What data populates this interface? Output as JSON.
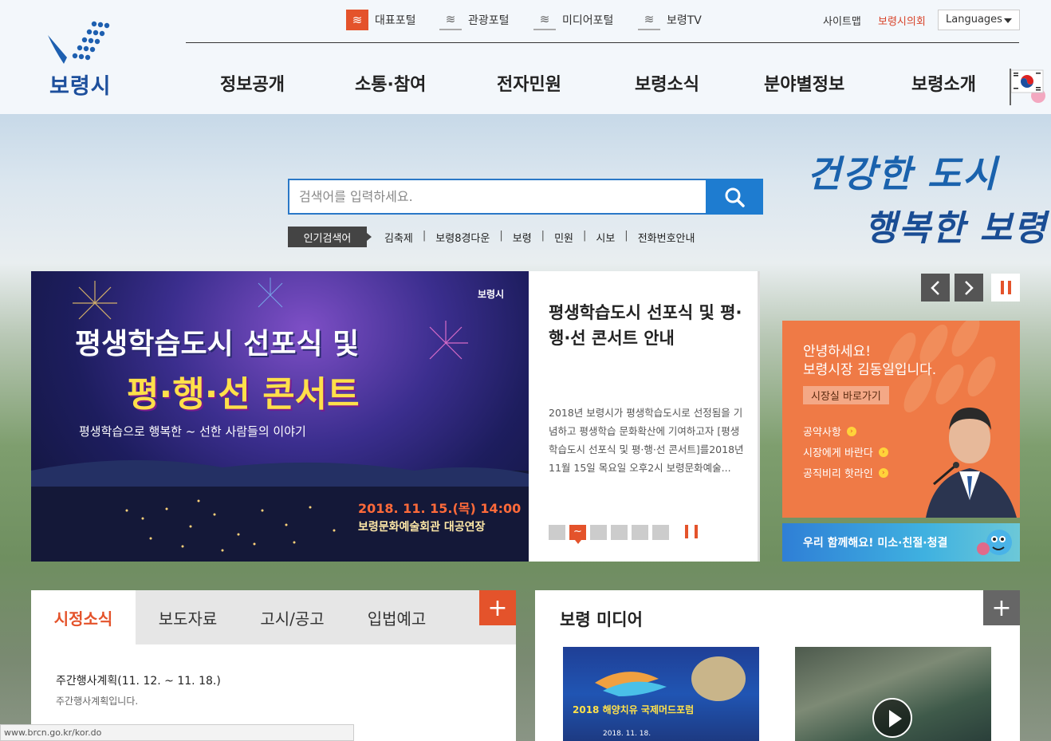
{
  "header": {
    "logo_text": "보령시",
    "portals": [
      {
        "label": "대표포털",
        "icon": "waves-icon",
        "active": true
      },
      {
        "label": "관광포털",
        "icon": "waves-icon",
        "active": false
      },
      {
        "label": "미디어포털",
        "icon": "waves-icon",
        "active": false
      },
      {
        "label": "보령TV",
        "icon": "waves-icon",
        "active": false
      }
    ],
    "util": {
      "sitemap": "사이트맵",
      "council": "보령시의회",
      "languages": "Languages"
    },
    "gnb": [
      "정보공개",
      "소통·참여",
      "전자민원",
      "보령소식",
      "분야별정보",
      "보령소개"
    ]
  },
  "slogan": {
    "line1": "건강한 도시",
    "line2": "행복한 보령"
  },
  "search": {
    "placeholder": "검색어를 입력하세요.",
    "popular_label": "인기검색어",
    "keywords": [
      "김축제",
      "보령8경다운",
      "보령",
      "민원",
      "시보",
      "전화번호안내"
    ]
  },
  "slide": {
    "title": "평생학습도시 선포식 및 평·행·선 콘서트 안내",
    "description": "2018년 보령시가 평생학습도시로 선정됨을 기념하고 평생학습 문화확산에 기여하고자 [평생학습도시 선포식 및 평·행·선 콘서트]를2018년 11월 15일 목요일 오후2시 보령문화예술...",
    "poster": {
      "brand": "보령시",
      "headline1": "평생학습도시 선포식 및",
      "headline2": "평·행·선 콘서트",
      "tagline": "평생학습으로 행복한 ~ 선한 사람들의 이야기",
      "date": "2018. 11. 15.(목) 14:00",
      "venue": "보령문화예술회관 대공연장"
    },
    "dot_count": 6,
    "active_dot_glyph": "~"
  },
  "mayor": {
    "greeting1": "안녕하세요!",
    "greeting2": "보령시장 김동일입니다.",
    "link": "시장실 바로가기",
    "links": [
      "공약사항",
      "시장에게 바란다",
      "공직비리 핫라인"
    ],
    "banner": "우리 함께해요! 미소·친절·청결"
  },
  "news": {
    "tabs": [
      "시정소식",
      "보도자료",
      "고시/공고",
      "입법예고"
    ],
    "active_tab": 0,
    "item_title": "주간행사계획(11. 12. ~ 11. 18.)",
    "item_desc": "주간행사계획입니다.",
    "more": "+"
  },
  "media": {
    "title": "보령 미디어",
    "more": "+",
    "thumb1_text": "2018 해양치유 국제머드포럼",
    "thumb1_date": "2018. 11. 18."
  },
  "statusbar": "www.brcn.go.kr/kor.do",
  "colors": {
    "accent": "#e4532b",
    "blue": "#1e7cd0",
    "mayor_bg": "#ef7a46"
  }
}
